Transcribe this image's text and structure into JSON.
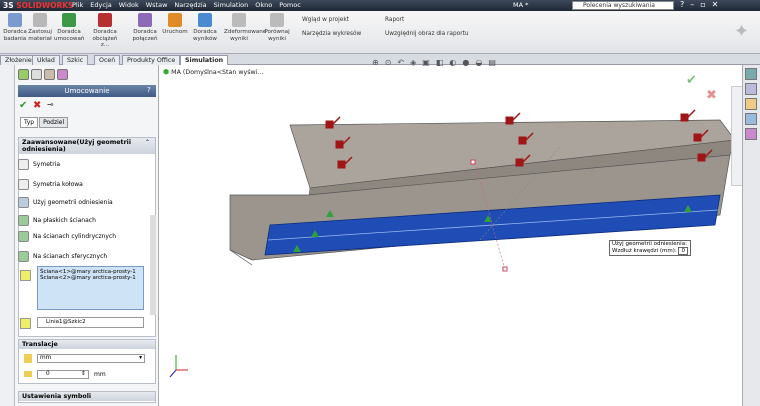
{
  "app": {
    "brand": "SOLIDWORKS",
    "logo_prefix": "3S",
    "menu": [
      "Plik",
      "Edycja",
      "Widok",
      "Wstaw",
      "Narzędzia",
      "Simulation",
      "Okno",
      "Pomoc"
    ],
    "doc_title": "MA *",
    "search_placeholder": "Polecenia wyszukiwania"
  },
  "ribbon": {
    "buttons": [
      "Doradca badania",
      "Zastosuj materiał",
      "Doradca umocowań",
      "Doradca obciążeń z...",
      "Doradca połączeń",
      "Uruchom",
      "Doradca wyników",
      "Zdeformowane wyniki",
      "Porównaj wyniki"
    ],
    "small": [
      "Wgląd w projekt",
      "Narzędzia wykresów",
      "Raport",
      "Uwzględnij obraz dla raportu"
    ]
  },
  "tabs": [
    "Złożenie",
    "Układ",
    "Szkic",
    "Oceń",
    "Produkty Office",
    "Simulation"
  ],
  "active_tab": "Simulation",
  "panel": {
    "title": "Umocowanie",
    "subtabs": [
      "Typ",
      "Podziel"
    ],
    "group_title": "Zaawansowane(Użyj geometrii odniesienia)",
    "options": [
      "Symetria",
      "Symetria kołowa",
      "Użyj geometrii odniesienia",
      "Na płaskich ścianach",
      "Na ścianach cylindrycznych",
      "Na ścianach sferycznych"
    ],
    "faces": [
      "Ściana<1>@mary arctica-prosty-1",
      "Ściana<2>@mary arctica-prosty-1"
    ],
    "edge": "Linia1@Szkic2",
    "translation_title": "Translacje",
    "unit": "mm",
    "value": "0",
    "value_unit": "mm",
    "symbols_title": "Ustawienia symboli"
  },
  "tree": {
    "item": "MA  (Domyślna<Stan wyświ..."
  },
  "callout": {
    "line1": "Użyj geometrii odniesienia:",
    "line2": "Wzdłuż krawędzi (mm):",
    "value": "0"
  },
  "colors": {
    "accent": "#3f5a85",
    "model_gray": "#9e9890",
    "face_blue": "#1f4db5",
    "arrow_red": "#a01515",
    "arrow_green": "#2fa03c"
  }
}
